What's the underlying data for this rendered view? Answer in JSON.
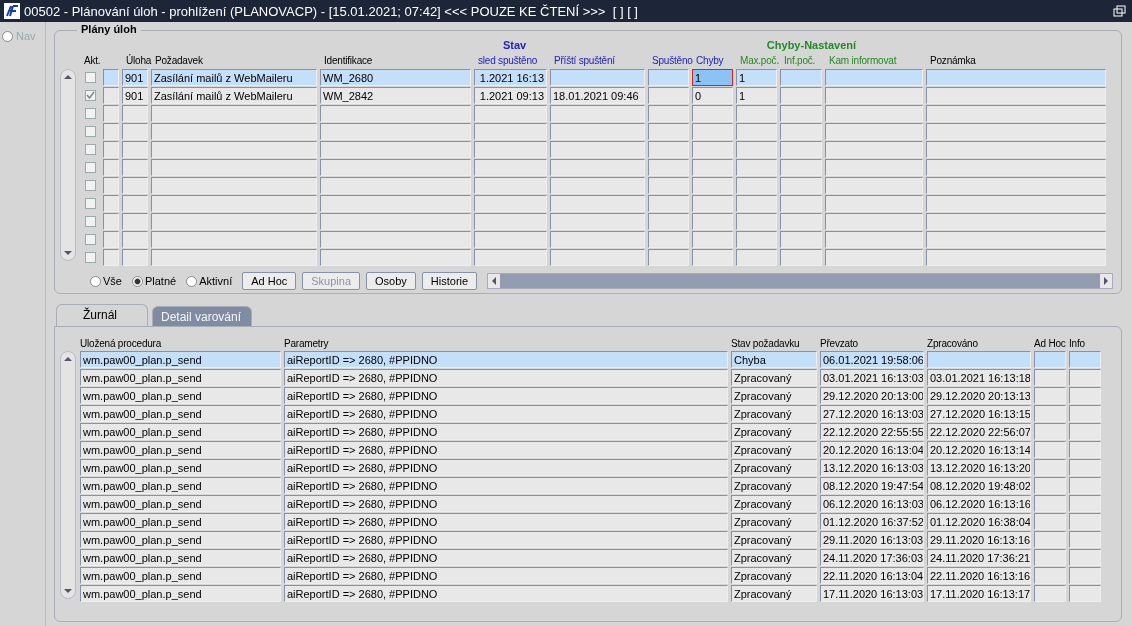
{
  "window": {
    "title": "00502 - Plánování úloh - prohlížení (PLANOVACP) - [15.01.2021; 07:42] <<< POUZE KE ČTENÍ >>>  [ ] [ ]"
  },
  "nav": {
    "label": "Nav",
    "selected": false
  },
  "plans": {
    "title": "Plány úloh",
    "groups": [
      {
        "label": "Stav",
        "kind": "status"
      },
      {
        "label": "Chyby-Nastavení",
        "kind": "errors"
      }
    ],
    "columns": [
      {
        "label": "Akt.",
        "kind": "plain"
      },
      {
        "label": "Úloha",
        "kind": "plain"
      },
      {
        "label": "Požadavek",
        "kind": "plain"
      },
      {
        "label": "Identifikace",
        "kind": "plain"
      },
      {
        "label": "sled spuštěno",
        "kind": "status"
      },
      {
        "label": "Příští spuštění",
        "kind": "status"
      },
      {
        "label": "Spuštěno",
        "kind": "status"
      },
      {
        "label": "Chyby",
        "kind": "status"
      },
      {
        "label": "Max.poč.",
        "kind": "errors"
      },
      {
        "label": "Inf.poč.",
        "kind": "errors"
      },
      {
        "label": "Kam informovat",
        "kind": "errors"
      },
      {
        "label": "Poznámka",
        "kind": "plain"
      }
    ],
    "rows": [
      {
        "checked": false,
        "selected": true,
        "task": "901",
        "request": "Zasílání mailů z WebMaileru",
        "ident": "WM_2680",
        "last_run": "1.2021 16:13",
        "errors": "1",
        "errors_invalid": true,
        "max": "1"
      },
      {
        "checked": true,
        "selected": false,
        "task": "901",
        "request": "Zasílání mailů z WebMaileru",
        "ident": "WM_2842",
        "last_run": "1.2021 09:13",
        "next_run": "18.01.2021 09:46",
        "errors": "0",
        "errors_invalid": false,
        "max": "1"
      },
      {
        "checked": false,
        "selected": false
      },
      {
        "checked": false,
        "selected": false
      },
      {
        "checked": false,
        "selected": false
      },
      {
        "checked": false,
        "selected": false
      },
      {
        "checked": false,
        "selected": false
      },
      {
        "checked": false,
        "selected": false
      },
      {
        "checked": false,
        "selected": false
      },
      {
        "checked": false,
        "selected": false
      },
      {
        "checked": false,
        "selected": false
      }
    ],
    "filters": [
      {
        "label": "Vše",
        "selected": false
      },
      {
        "label": "Platné",
        "selected": true
      },
      {
        "label": "Aktivní",
        "selected": false
      }
    ],
    "buttons": [
      {
        "label": "Ad Hoc",
        "disabled": false
      },
      {
        "label": "Skupina",
        "disabled": true
      },
      {
        "label": "Osoby",
        "disabled": false
      },
      {
        "label": "Historie",
        "disabled": false
      }
    ]
  },
  "tabs": [
    {
      "label": "Žurnál",
      "selected": true
    },
    {
      "label": "Detail varování",
      "selected": false
    }
  ],
  "journal": {
    "columns": [
      "Uložená procedura",
      "Parametry",
      "Stav požadavku",
      "Převzato",
      "Zpracováno",
      "Ad Hoc",
      "Info"
    ],
    "rows": [
      {
        "selected": true,
        "procedure": "wm.paw00_plan.p_send",
        "params": "aiReportID => 2680, #PPIDNO",
        "state": "Chyba",
        "taken": "06.01.2021 19:58:06"
      },
      {
        "selected": false,
        "procedure": "wm.paw00_plan.p_send",
        "params": "aiReportID => 2680, #PPIDNO",
        "state": "Zpracovaný",
        "taken": "03.01.2021 16:13:03",
        "done": "03.01.2021 16:13:18"
      },
      {
        "selected": false,
        "procedure": "wm.paw00_plan.p_send",
        "params": "aiReportID => 2680, #PPIDNO",
        "state": "Zpracovaný",
        "taken": "29.12.2020 20:13:00",
        "done": "29.12.2020 20:13:13"
      },
      {
        "selected": false,
        "procedure": "wm.paw00_plan.p_send",
        "params": "aiReportID => 2680, #PPIDNO",
        "state": "Zpracovaný",
        "taken": "27.12.2020 16:13:03",
        "done": "27.12.2020 16:13:15"
      },
      {
        "selected": false,
        "procedure": "wm.paw00_plan.p_send",
        "params": "aiReportID => 2680, #PPIDNO",
        "state": "Zpracovaný",
        "taken": "22.12.2020 22:55:55",
        "done": "22.12.2020 22:56:07"
      },
      {
        "selected": false,
        "procedure": "wm.paw00_plan.p_send",
        "params": "aiReportID => 2680, #PPIDNO",
        "state": "Zpracovaný",
        "taken": "20.12.2020 16:13:04",
        "done": "20.12.2020 16:13:14"
      },
      {
        "selected": false,
        "procedure": "wm.paw00_plan.p_send",
        "params": "aiReportID => 2680, #PPIDNO",
        "state": "Zpracovaný",
        "taken": "13.12.2020 16:13:03",
        "done": "13.12.2020 16:13:20"
      },
      {
        "selected": false,
        "procedure": "wm.paw00_plan.p_send",
        "params": "aiReportID => 2680, #PPIDNO",
        "state": "Zpracovaný",
        "taken": "08.12.2020 19:47:54",
        "done": "08.12.2020 19:48:02"
      },
      {
        "selected": false,
        "procedure": "wm.paw00_plan.p_send",
        "params": "aiReportID => 2680, #PPIDNO",
        "state": "Zpracovaný",
        "taken": "06.12.2020 16:13:03",
        "done": "06.12.2020 16:13:16"
      },
      {
        "selected": false,
        "procedure": "wm.paw00_plan.p_send",
        "params": "aiReportID => 2680, #PPIDNO",
        "state": "Zpracovaný",
        "taken": "01.12.2020 16:37:52",
        "done": "01.12.2020 16:38:04"
      },
      {
        "selected": false,
        "procedure": "wm.paw00_plan.p_send",
        "params": "aiReportID => 2680, #PPIDNO",
        "state": "Zpracovaný",
        "taken": "29.11.2020 16:13:03",
        "done": "29.11.2020 16:13:16"
      },
      {
        "selected": false,
        "procedure": "wm.paw00_plan.p_send",
        "params": "aiReportID => 2680, #PPIDNO",
        "state": "Zpracovaný",
        "taken": "24.11.2020 17:36:03",
        "done": "24.11.2020 17:36:21"
      },
      {
        "selected": false,
        "procedure": "wm.paw00_plan.p_send",
        "params": "aiReportID => 2680, #PPIDNO",
        "state": "Zpracovaný",
        "taken": "22.11.2020 16:13:04",
        "done": "22.11.2020 16:13:16"
      },
      {
        "selected": false,
        "procedure": "wm.paw00_plan.p_send",
        "params": "aiReportID => 2680, #PPIDNO",
        "state": "Zpracovaný",
        "taken": "17.11.2020 16:13:03",
        "done": "17.11.2020 16:13:17"
      }
    ]
  }
}
